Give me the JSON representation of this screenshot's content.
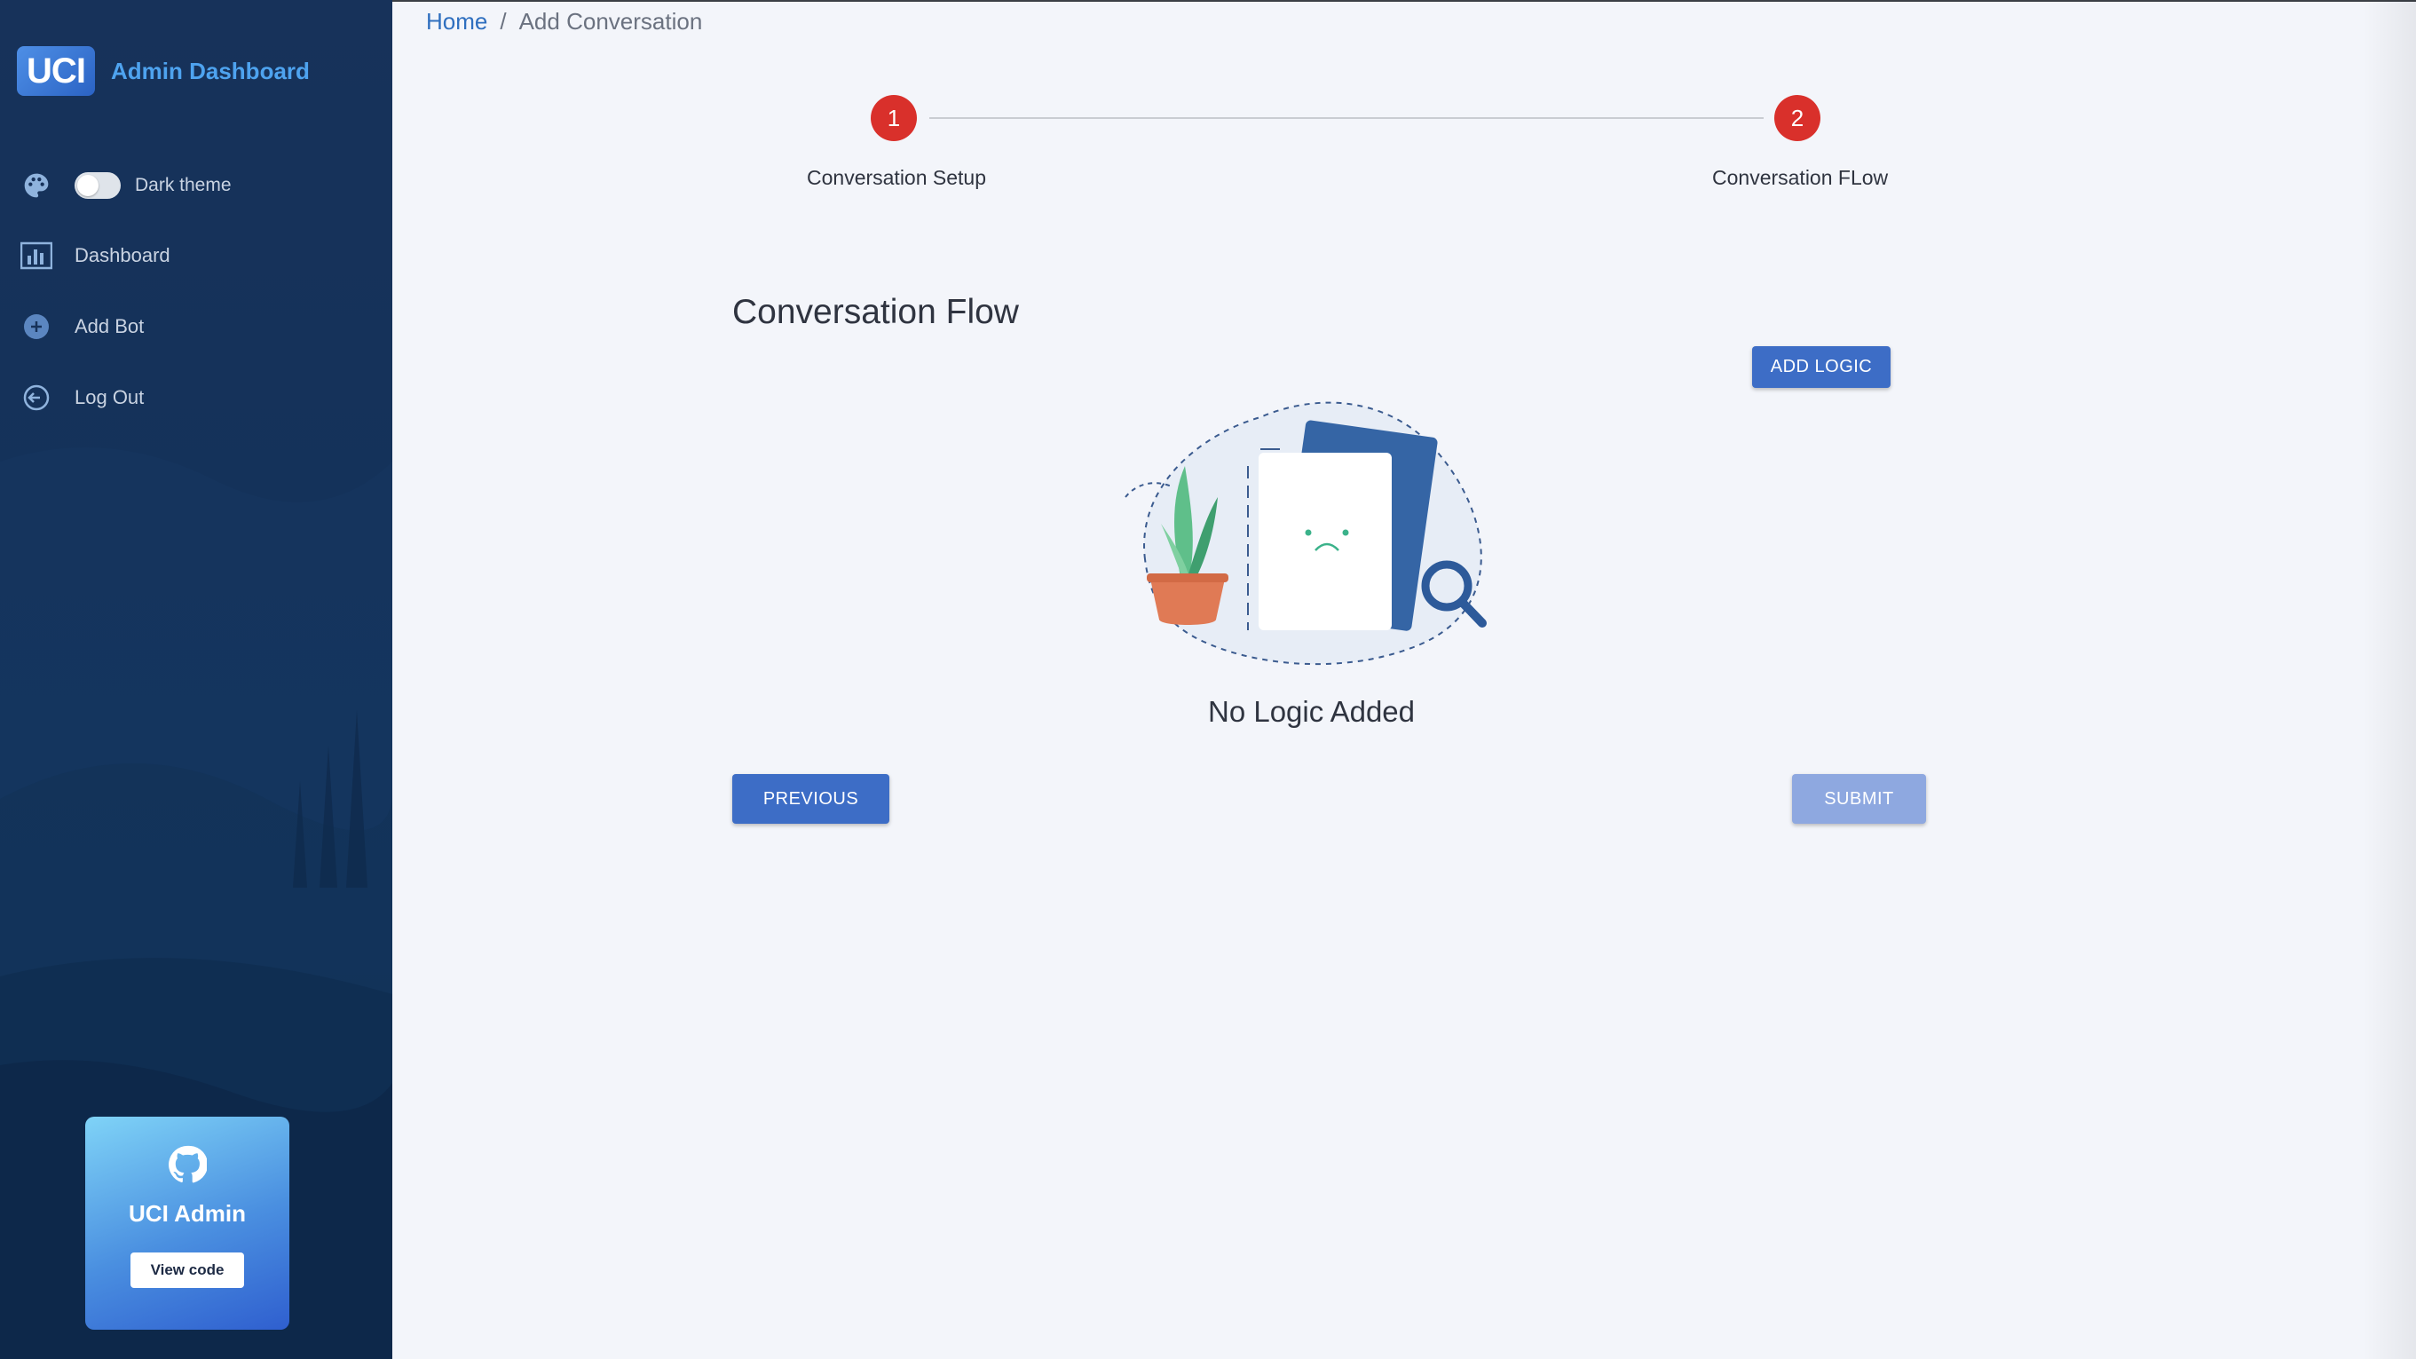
{
  "brand": {
    "logo_text": "UCI",
    "title": "Admin Dashboard"
  },
  "sidebar": {
    "theme_toggle": {
      "label": "Dark theme",
      "on": false
    },
    "items": [
      {
        "label": "Dashboard",
        "icon": "bar-chart-icon"
      },
      {
        "label": "Add Bot",
        "icon": "plus-circle-icon"
      },
      {
        "label": "Log Out",
        "icon": "logout-icon"
      }
    ],
    "card": {
      "icon": "github-icon",
      "title": "UCI Admin",
      "button_label": "View code"
    }
  },
  "breadcrumb": {
    "home": "Home",
    "separator": "/",
    "current": "Add Conversation"
  },
  "stepper": {
    "steps": [
      {
        "number": "1",
        "label": "Conversation Setup"
      },
      {
        "number": "2",
        "label": "Conversation FLow"
      }
    ],
    "step_color": "#d9302b"
  },
  "main": {
    "section_title": "Conversation Flow",
    "add_logic_label": "ADD LOGIC",
    "empty_state_text": "No Logic Added",
    "previous_label": "PREVIOUS",
    "submit_label": "SUBMIT"
  },
  "colors": {
    "primary": "#3d6dc6",
    "sidebar_bg": "#14325a",
    "accent_text": "#4ea3ef"
  }
}
